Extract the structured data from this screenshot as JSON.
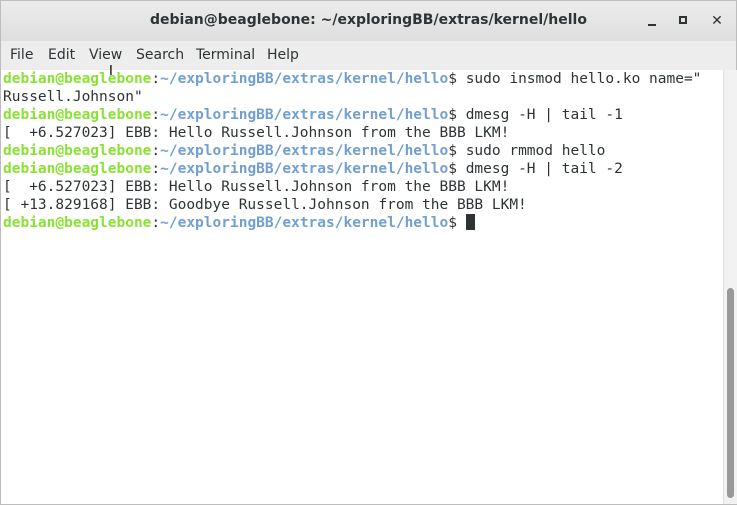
{
  "window": {
    "title": "debian@beaglebone: ~/exploringBB/extras/kernel/hello",
    "buttons": {
      "minimize_icon": "minimize-icon",
      "maximize_icon": "maximize-icon",
      "close_icon": "close-icon"
    }
  },
  "menu": [
    "File",
    "Edit",
    "View",
    "Search",
    "Terminal",
    "Help"
  ],
  "prompt": {
    "user": "debian@beaglebone",
    "sep": ":",
    "path": "~/exploringBB/extras/kernel/hello",
    "dollar": "$ "
  },
  "lines": [
    {
      "type": "prompt",
      "cmd": "sudo insmod hello.ko name=\""
    },
    {
      "type": "output",
      "text": "Russell.Johnson\""
    },
    {
      "type": "prompt",
      "cmd": "dmesg -H | tail -1"
    },
    {
      "type": "output",
      "text": "[  +6.527023] EBB: Hello Russell.Johnson from the BBB LKM!"
    },
    {
      "type": "prompt",
      "cmd": "sudo rmmod hello"
    },
    {
      "type": "prompt",
      "cmd": "dmesg -H | tail -2"
    },
    {
      "type": "output",
      "text": "[  +6.527023] EBB: Hello Russell.Johnson from the BBB LKM!"
    },
    {
      "type": "output",
      "text": "[ +13.829168] EBB: Goodbye Russell.Johnson from the BBB LKM!"
    },
    {
      "type": "prompt",
      "cmd": ""
    }
  ],
  "colors": {
    "user": "#8ae234",
    "path": "#729fcf",
    "text": "#2e3436",
    "background": "#ffffff"
  }
}
